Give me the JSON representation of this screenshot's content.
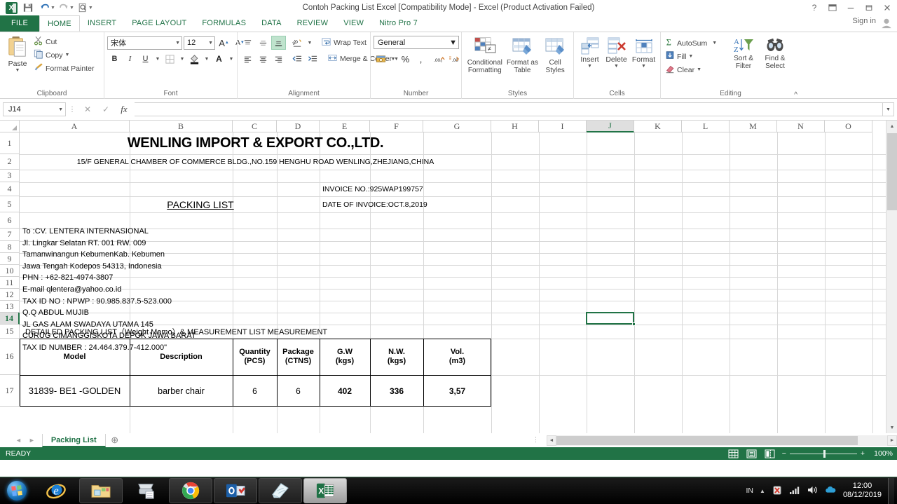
{
  "window": {
    "title": "Contoh Packing List Excel  [Compatibility Mode] - Excel (Product Activation Failed)",
    "help_icon": "?",
    "ribbon_display_icon": "ribbon-display-options",
    "minimize_icon": "–",
    "restore_icon": "restore",
    "close_icon": "✕",
    "signin_label": "Sign in"
  },
  "quick_access": {
    "excel_logo": "excel-logo",
    "save": "save-icon",
    "undo": "undo-icon",
    "redo": "redo-icon",
    "print_preview": "print-preview-icon",
    "customize": "customize-qat-icon"
  },
  "ribbon_tabs": [
    {
      "label": "FILE",
      "active": false,
      "file": true
    },
    {
      "label": "HOME",
      "active": true
    },
    {
      "label": "INSERT",
      "active": false
    },
    {
      "label": "PAGE LAYOUT",
      "active": false
    },
    {
      "label": "FORMULAS",
      "active": false
    },
    {
      "label": "DATA",
      "active": false
    },
    {
      "label": "REVIEW",
      "active": false
    },
    {
      "label": "VIEW",
      "active": false
    },
    {
      "label": "Nitro Pro 7",
      "active": false
    }
  ],
  "ribbon": {
    "clipboard": {
      "title": "Clipboard",
      "paste": "Paste",
      "cut": "Cut",
      "copy": "Copy",
      "format_painter": "Format Painter"
    },
    "font": {
      "title": "Font",
      "font_name": "宋体",
      "font_size": "12",
      "grow_font": "A",
      "shrink_font": "A",
      "bold": "B",
      "italic": "I",
      "underline": "U",
      "borders": "borders-icon",
      "fill_color": "fill-color-icon",
      "font_color": "A"
    },
    "alignment": {
      "title": "Alignment",
      "wrap_text": "Wrap Text",
      "merge_center": "Merge & Center",
      "orientation": "orientation-icon",
      "decrease_indent": "decrease-indent-icon",
      "increase_indent": "increase-indent-icon"
    },
    "number": {
      "title": "Number",
      "format": "General",
      "accounting": "accounting-format-icon",
      "percent": "%",
      "comma": ",",
      "increase_decimal": "increase-decimal-icon",
      "decrease_decimal": "decrease-decimal-icon"
    },
    "styles": {
      "title": "Styles",
      "conditional_formatting": "Conditional Formatting",
      "format_as_table": "Format as Table",
      "cell_styles": "Cell Styles"
    },
    "cells": {
      "title": "Cells",
      "insert": "Insert",
      "delete": "Delete",
      "format": "Format"
    },
    "editing": {
      "title": "Editing",
      "autosum": "AutoSum",
      "fill": "Fill",
      "clear": "Clear",
      "sort_filter": "Sort & Filter",
      "find_select": "Find & Select",
      "collapse_ribbon": "collapse-ribbon-icon"
    }
  },
  "formula_bar": {
    "name_box": "J14",
    "cancel_icon": "✕",
    "enter_icon": "✓",
    "function_icon": "fx",
    "value": "",
    "expand_icon": "expand-formula-bar-icon"
  },
  "grid": {
    "columns": [
      "A",
      "B",
      "C",
      "D",
      "E",
      "F",
      "G",
      "H",
      "I",
      "J",
      "K",
      "L",
      "M",
      "N",
      "O"
    ],
    "selected_column": "J",
    "selected_row": "14",
    "rows": [
      "1",
      "2",
      "3",
      "4",
      "5",
      "6",
      "7",
      "8",
      "9",
      "10",
      "11",
      "12",
      "13",
      "14",
      "15",
      "16",
      "17"
    ],
    "cells": {
      "company_name": "WENLING IMPORT & EXPORT CO.,LTD.",
      "company_address": "15/F GENERAL CHAMBER OF COMMERCE BLDG.,NO.159 HENGHU ROAD WENLING,ZHEJIANG,CHINA",
      "packing_list_title": "PACKING LIST",
      "invoice_no": "INVOICE NO.:925WAP199757",
      "date_of_invoice": "DATE OF INVOICE:OCT.8,2019",
      "consignee": [
        "To :CV. LENTERA INTERNASIONAL",
        "Jl. Lingkar  Selatan RT. 001 RW. 009",
        "Tamanwinangun KebumenKab. Kebumen",
        "Jawa Tengah  Kodepos 54313, Indonesia",
        "PHN : +62-821-4974-3807",
        "E-mail qlentera@yahoo.co.id",
        "TAX ID NO : NPWP : 90.985.837.5-523.000",
        "Q.Q  ABDUL MUJIB",
        "JL GAS ALAM SWADAYA UTAMA 145",
        "CURUG CIMANGGISKOTA DEPOK JAWA BARAT",
        "TAX ID NUMBER : 24.464.379.7-412.000\""
      ],
      "detail_line": "DETAILED PACKING LIST（Weight Memo）& MEASUREMENT LIST MEASUREMENT"
    },
    "table": {
      "headers": [
        {
          "line1": "Model",
          "line2": ""
        },
        {
          "line1": "Description",
          "line2": ""
        },
        {
          "line1": "Quantity",
          "line2": "(PCS)"
        },
        {
          "line1": "Package",
          "line2": "(CTNS)"
        },
        {
          "line1": "G.W",
          "line2": "(kgs)"
        },
        {
          "line1": "N.W.",
          "line2": "(kgs)"
        },
        {
          "line1": "Vol.",
          "line2": "(m3)"
        }
      ],
      "rows": [
        [
          "31839- BE1 -GOLDEN",
          "barber  chair",
          "6",
          "6",
          "402",
          "336",
          "3,57"
        ]
      ]
    }
  },
  "sheet_tabs": {
    "first_icon": "◄",
    "prev_icon": "►",
    "tabs": [
      {
        "label": "Packing List",
        "active": true
      }
    ],
    "add_icon": "+"
  },
  "status_bar": {
    "mode": "READY",
    "view_normal": "normal-view-icon",
    "view_pagelayout": "page-layout-view-icon",
    "view_pagebreak": "page-break-preview-icon",
    "zoom_out": "−",
    "zoom_in": "+",
    "zoom_level": "100%"
  },
  "taskbar": {
    "start": "windows-start-orb",
    "items": [
      {
        "name": "internet-explorer",
        "active": false,
        "framed": false
      },
      {
        "name": "file-explorer",
        "active": false,
        "framed": true
      },
      {
        "name": "printer-scanner",
        "active": false,
        "framed": false
      },
      {
        "name": "google-chrome",
        "active": false,
        "framed": true
      },
      {
        "name": "microsoft-outlook",
        "active": false,
        "framed": true
      },
      {
        "name": "sticky-notes",
        "active": false,
        "framed": true
      },
      {
        "name": "microsoft-excel",
        "active": true,
        "framed": true
      }
    ],
    "tray": {
      "language": "IN",
      "show_hidden": "▲",
      "antivirus": "antivirus-icon",
      "network": "network-signal-icon",
      "volume": "volume-icon",
      "cloud": "onedrive-icon",
      "time": "12:00",
      "date": "08/12/2019"
    }
  },
  "colors": {
    "excel_green": "#217346",
    "selection_green": "#217346",
    "taskbar_black": "#000000"
  }
}
